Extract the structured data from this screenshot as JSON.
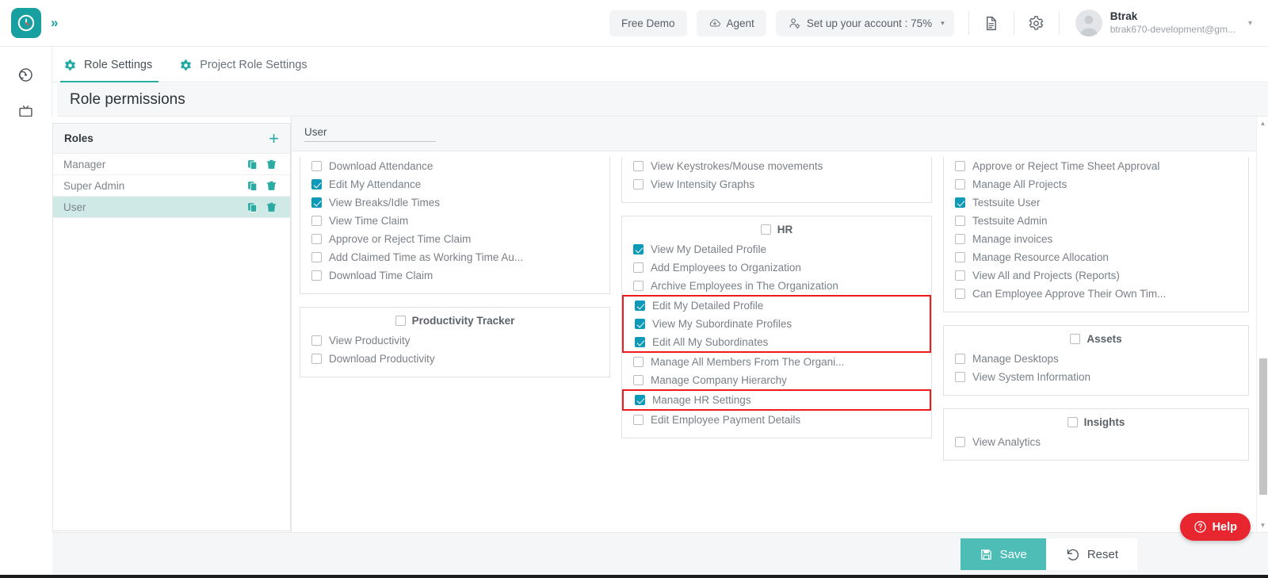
{
  "app": {
    "logo_icon": "clock-logo-icon",
    "expand_icon": "chevron-double-right-icon"
  },
  "topbar": {
    "free_demo_label": "Free Demo",
    "agent_label": "Agent",
    "agent_icon": "cloud-download-icon",
    "setup_label": "Set up your account : 75%",
    "setup_icon": "user-gear-icon",
    "setup_caret": "▾",
    "doc_icon": "document-icon",
    "gear_icon": "gear-icon",
    "user": {
      "name": "Btrak",
      "email": "btrak670-development@gm...",
      "avatar_icon": "avatar-icon",
      "caret": "▾"
    }
  },
  "rail": {
    "items": [
      {
        "icon": "target-dashboard-icon"
      },
      {
        "icon": "tv-screen-icon"
      },
      {
        "icon": "calendar-icon"
      },
      {
        "icon": "person-icon"
      },
      {
        "icon": "briefcase-icon"
      },
      {
        "icon": "people-group-icon"
      },
      {
        "icon": "team-hierarchy-icon"
      },
      {
        "icon": "settings-gear-icon"
      },
      {
        "icon": "user-badge-icon"
      },
      {
        "icon": "alarm-clock-icon"
      }
    ]
  },
  "tabs": [
    {
      "label": "Role Settings",
      "icon": "gear-icon",
      "active": true
    },
    {
      "label": "Project Role Settings",
      "icon": "gear-icon",
      "active": false
    }
  ],
  "page": {
    "title": "Role permissions"
  },
  "roles_panel": {
    "header": "Roles",
    "add_icon": "plus-icon",
    "copy_icon": "copy-icon",
    "delete_icon": "trash-icon",
    "rows": [
      {
        "name": "Manager",
        "selected": false
      },
      {
        "name": "Super Admin",
        "selected": false
      },
      {
        "name": "User",
        "selected": true
      }
    ]
  },
  "permissions": {
    "role_name_value": "User",
    "columns": [
      {
        "groups": [
          {
            "title": null,
            "clipped": true,
            "items": [
              {
                "label": "Download Attendance",
                "checked": false
              },
              {
                "label": "Edit My Attendance",
                "checked": true
              },
              {
                "label": "View Breaks/Idle Times",
                "checked": true
              },
              {
                "label": "View Time Claim",
                "checked": false
              },
              {
                "label": "Approve or Reject Time Claim",
                "checked": false
              },
              {
                "label": "Add Claimed Time as Working Time Au...",
                "checked": false
              },
              {
                "label": "Download Time Claim",
                "checked": false
              }
            ]
          },
          {
            "title": "Productivity Tracker",
            "title_checked": false,
            "clipped": false,
            "items": [
              {
                "label": "View Productivity",
                "checked": false
              },
              {
                "label": "Download Productivity",
                "checked": false
              }
            ]
          }
        ]
      },
      {
        "groups": [
          {
            "title": null,
            "clipped": true,
            "items": [
              {
                "label": "View Keystrokes/Mouse movements",
                "checked": false
              },
              {
                "label": "View Intensity Graphs",
                "checked": false
              }
            ]
          },
          {
            "title": "HR",
            "title_checked": false,
            "clipped": false,
            "items": [
              {
                "label": "View My Detailed Profile",
                "checked": true
              },
              {
                "label": "Add Employees to Organization",
                "checked": false
              },
              {
                "label": "Archive Employees in The Organization",
                "checked": false
              },
              {
                "label": "Edit My Detailed Profile",
                "checked": true,
                "highlight_group": "a"
              },
              {
                "label": "View My Subordinate Profiles",
                "checked": true,
                "highlight_group": "a"
              },
              {
                "label": "Edit All My Subordinates",
                "checked": true,
                "highlight_group": "a"
              },
              {
                "label": "Manage All Members From The Organi...",
                "checked": false
              },
              {
                "label": "Manage Company Hierarchy",
                "checked": false
              },
              {
                "label": "Manage HR Settings",
                "checked": true,
                "highlight_group": "b"
              },
              {
                "label": "Edit Employee Payment Details",
                "checked": false
              }
            ]
          }
        ]
      },
      {
        "groups": [
          {
            "title": null,
            "clipped": true,
            "items": [
              {
                "label": "Approve or Reject Time Sheet Approval",
                "checked": false
              },
              {
                "label": "Manage All Projects",
                "checked": false
              },
              {
                "label": "Testsuite User",
                "checked": true
              },
              {
                "label": "Testsuite Admin",
                "checked": false
              },
              {
                "label": "Manage invoices",
                "checked": false
              },
              {
                "label": "Manage Resource Allocation",
                "checked": false
              },
              {
                "label": "View All and Projects (Reports)",
                "checked": false
              },
              {
                "label": "Can Employee Approve Their Own Tim...",
                "checked": false
              }
            ]
          },
          {
            "title": "Assets",
            "title_checked": false,
            "clipped": false,
            "items": [
              {
                "label": "Manage Desktops",
                "checked": false
              },
              {
                "label": "View System Information",
                "checked": false
              }
            ]
          },
          {
            "title": "Insights",
            "title_checked": false,
            "clipped": false,
            "items": [
              {
                "label": "View Analytics",
                "checked": false
              }
            ]
          }
        ]
      }
    ]
  },
  "footer": {
    "save_label": "Save",
    "save_icon": "floppy-save-icon",
    "reset_label": "Reset",
    "reset_icon": "undo-icon"
  },
  "help": {
    "label": "Help",
    "icon": "question-circle-icon"
  },
  "scrollbar": {
    "up_arrow": "▲",
    "down_arrow": "▼"
  },
  "colors": {
    "brand_teal": "#18a0a0",
    "tab_underline": "#2aaba2",
    "checkbox_checked": "#0d99b8",
    "selected_role_bg": "#cfe9e6",
    "highlight_red": "#ee1c1c",
    "save_button": "#4dbdb5",
    "help_button": "#e8262f"
  }
}
